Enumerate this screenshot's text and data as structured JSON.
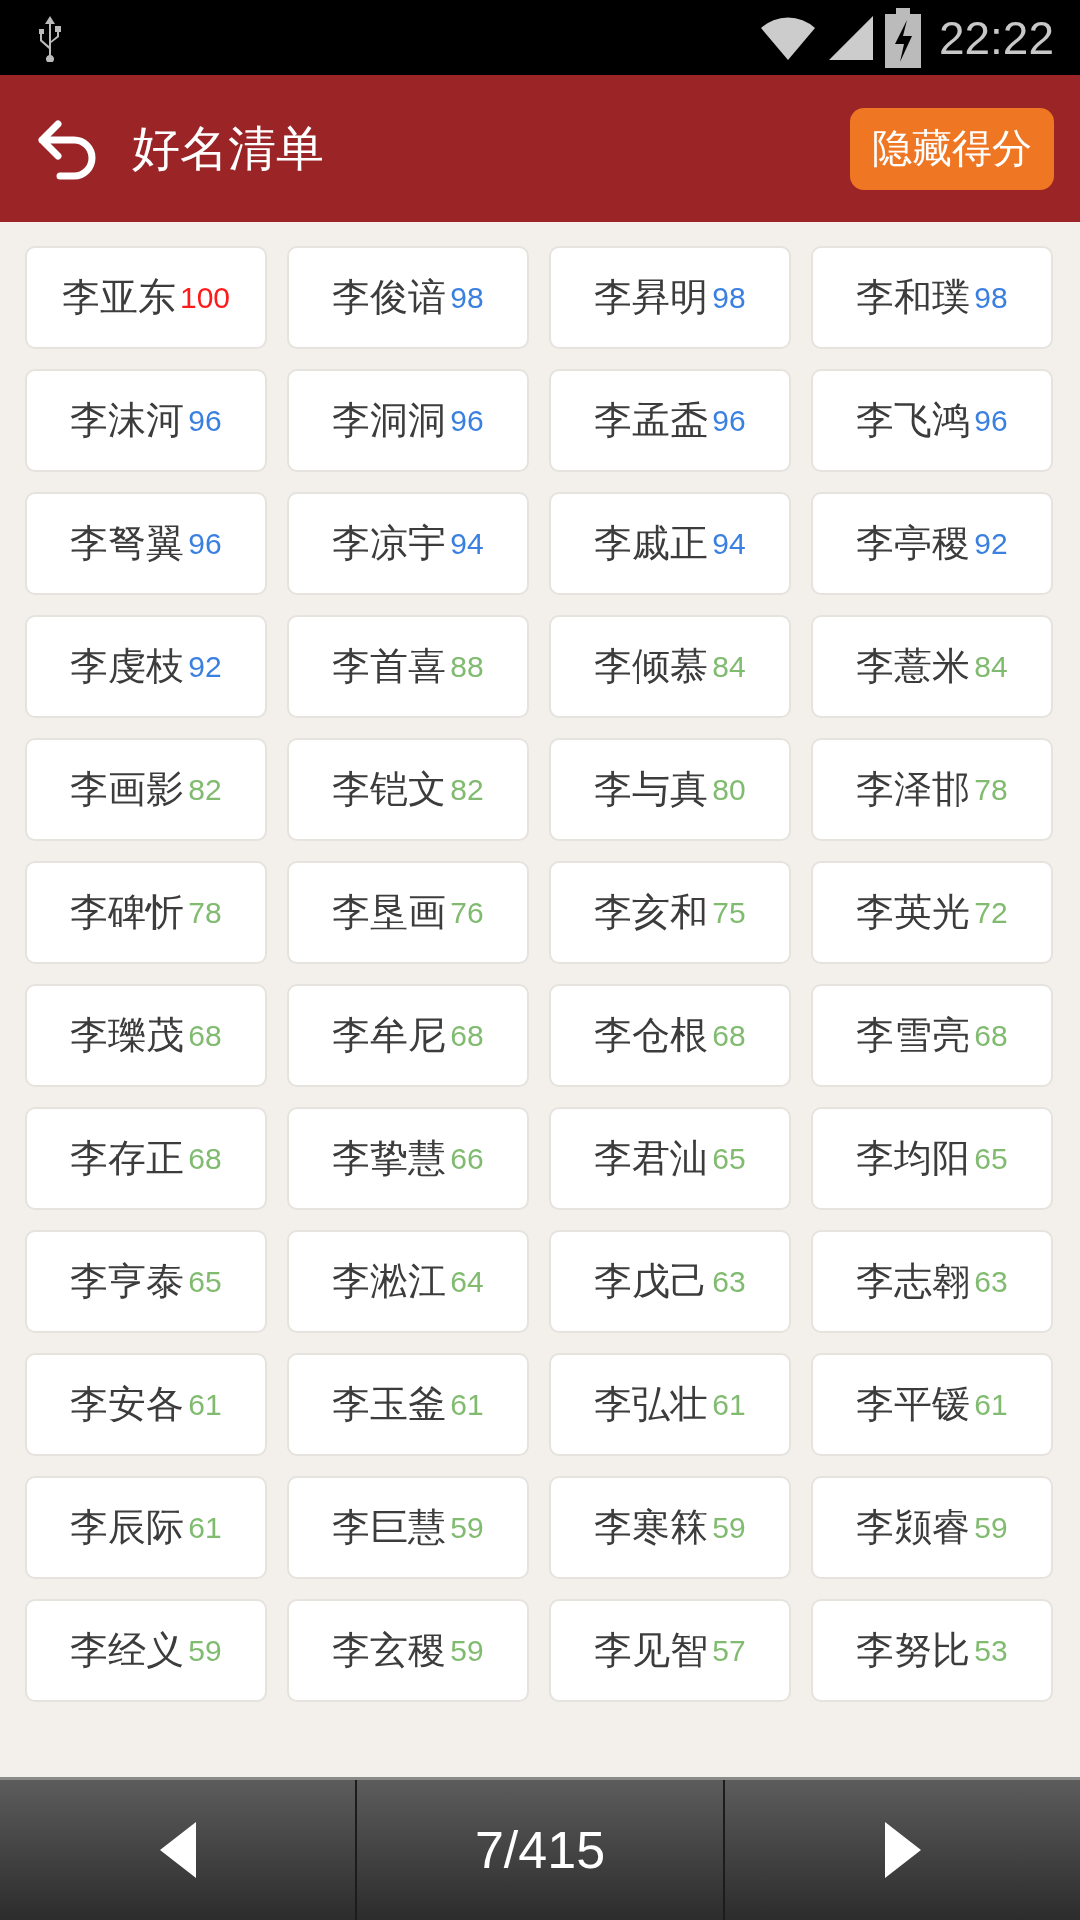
{
  "status_bar": {
    "time": "22:22"
  },
  "header": {
    "title": "好名清单",
    "button": "隐藏得分"
  },
  "names": [
    {
      "name": "李亚东",
      "score": "100",
      "color": "#ff1a1a"
    },
    {
      "name": "李俊谙",
      "score": "98",
      "color": "#3a80e0"
    },
    {
      "name": "李昪明",
      "score": "98",
      "color": "#3a80e0"
    },
    {
      "name": "李和璞",
      "score": "98",
      "color": "#3a80e0"
    },
    {
      "name": "李沫河",
      "score": "96",
      "color": "#3a80e0"
    },
    {
      "name": "李洞洞",
      "score": "96",
      "color": "#3a80e0"
    },
    {
      "name": "李孟盉",
      "score": "96",
      "color": "#3a80e0"
    },
    {
      "name": "李飞鸿",
      "score": "96",
      "color": "#3a80e0"
    },
    {
      "name": "李弩翼",
      "score": "96",
      "color": "#3a80e0"
    },
    {
      "name": "李凉宇",
      "score": "94",
      "color": "#3a80e0"
    },
    {
      "name": "李戚正",
      "score": "94",
      "color": "#3a80e0"
    },
    {
      "name": "李亭稷",
      "score": "92",
      "color": "#3a80e0"
    },
    {
      "name": "李虔枝",
      "score": "92",
      "color": "#3a80e0"
    },
    {
      "name": "李首喜",
      "score": "88",
      "color": "#80bb70"
    },
    {
      "name": "李倾慕",
      "score": "84",
      "color": "#80bb70"
    },
    {
      "name": "李薏米",
      "score": "84",
      "color": "#80bb70"
    },
    {
      "name": "李画影",
      "score": "82",
      "color": "#80bb70"
    },
    {
      "name": "李铠文",
      "score": "82",
      "color": "#80bb70"
    },
    {
      "name": "李与真",
      "score": "80",
      "color": "#80bb70"
    },
    {
      "name": "李泽邯",
      "score": "78",
      "color": "#80bb70"
    },
    {
      "name": "李碑忻",
      "score": "78",
      "color": "#80bb70"
    },
    {
      "name": "李垦画",
      "score": "76",
      "color": "#80bb70"
    },
    {
      "name": "李亥和",
      "score": "75",
      "color": "#80bb70"
    },
    {
      "name": "李英光",
      "score": "72",
      "color": "#80bb70"
    },
    {
      "name": "李瓅茂",
      "score": "68",
      "color": "#80bb70"
    },
    {
      "name": "李牟尼",
      "score": "68",
      "color": "#80bb70"
    },
    {
      "name": "李仓根",
      "score": "68",
      "color": "#80bb70"
    },
    {
      "name": "李雪亮",
      "score": "68",
      "color": "#80bb70"
    },
    {
      "name": "李存正",
      "score": "68",
      "color": "#80bb70"
    },
    {
      "name": "李挚慧",
      "score": "66",
      "color": "#80bb70"
    },
    {
      "name": "李君汕",
      "score": "65",
      "color": "#80bb70"
    },
    {
      "name": "李均阳",
      "score": "65",
      "color": "#80bb70"
    },
    {
      "name": "李亨泰",
      "score": "65",
      "color": "#80bb70"
    },
    {
      "name": "李淞江",
      "score": "64",
      "color": "#80bb70"
    },
    {
      "name": "李戊己",
      "score": "63",
      "color": "#80bb70"
    },
    {
      "name": "李志翱",
      "score": "63",
      "color": "#80bb70"
    },
    {
      "name": "李安各",
      "score": "61",
      "color": "#80bb70"
    },
    {
      "name": "李玉釜",
      "score": "61",
      "color": "#80bb70"
    },
    {
      "name": "李弘壮",
      "score": "61",
      "color": "#80bb70"
    },
    {
      "name": "李平锾",
      "score": "61",
      "color": "#80bb70"
    },
    {
      "name": "李辰际",
      "score": "61",
      "color": "#80bb70"
    },
    {
      "name": "李巨慧",
      "score": "59",
      "color": "#80bb70"
    },
    {
      "name": "李寒箖",
      "score": "59",
      "color": "#80bb70"
    },
    {
      "name": "李颎睿",
      "score": "59",
      "color": "#80bb70"
    },
    {
      "name": "李经义",
      "score": "59",
      "color": "#80bb70"
    },
    {
      "name": "李玄稷",
      "score": "59",
      "color": "#80bb70"
    },
    {
      "name": "李见智",
      "score": "57",
      "color": "#80bb70"
    },
    {
      "name": "李努比",
      "score": "53",
      "color": "#80bb70"
    }
  ],
  "pager": {
    "page": "7/415"
  }
}
